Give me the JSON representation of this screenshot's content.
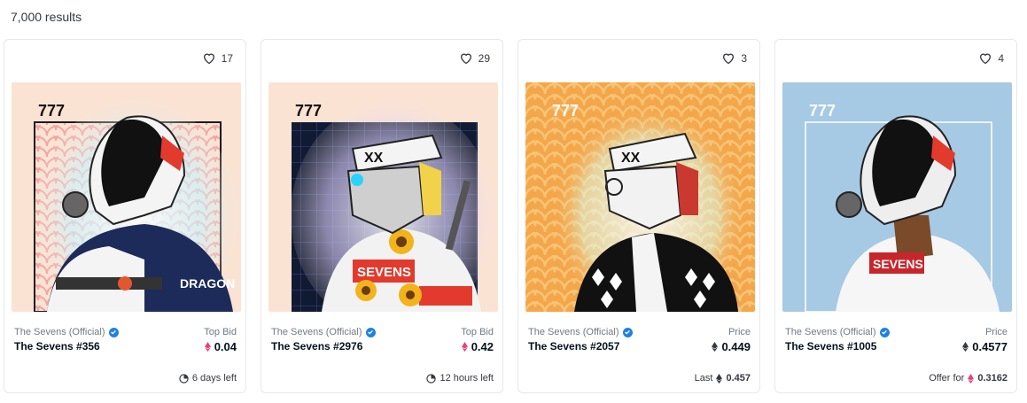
{
  "results_text": "7,000 results",
  "colors": {
    "accent": "#2081e2",
    "eth_pink": "#e0467c",
    "eth_dark": "#353840"
  },
  "cards": [
    {
      "likes": "17",
      "collection": "The Sevens (Official)",
      "name": "The Sevens #356",
      "price_label": "Top Bid",
      "price": "0.04",
      "price_icon": "eth-weth-icon",
      "footer_prefix": "",
      "footer_value": "6 days left",
      "footer_icon": "clock-icon",
      "bg": "#fbe3d3",
      "pattern": "#f3a4a2",
      "frame_num": "777",
      "jacket": "DRAGON"
    },
    {
      "likes": "29",
      "collection": "The Sevens (Official)",
      "name": "The Sevens #2976",
      "price_label": "Top Bid",
      "price": "0.42",
      "price_icon": "eth-weth-icon",
      "footer_prefix": "",
      "footer_value": "12 hours left",
      "footer_icon": "clock-icon",
      "bg": "#fbe3d3",
      "pattern": "#1d2a4a",
      "frame_num": "777",
      "jacket": "SEVENS"
    },
    {
      "likes": "3",
      "collection": "The Sevens (Official)",
      "name": "The Sevens #2057",
      "price_label": "Price",
      "price": "0.449",
      "price_icon": "eth-icon",
      "footer_prefix": "Last",
      "footer_value": "0.457",
      "footer_icon": "eth-icon",
      "bg": "#f4a64a",
      "pattern": "#f7c476",
      "frame_num": "777",
      "jacket": ""
    },
    {
      "likes": "4",
      "collection": "The Sevens (Official)",
      "name": "The Sevens #1005",
      "price_label": "Price",
      "price": "0.4577",
      "price_icon": "eth-icon",
      "footer_prefix": "Offer for",
      "footer_value": "0.3162",
      "footer_icon": "eth-weth-icon",
      "bg": "#a6c9e4",
      "pattern": "#a6c9e4",
      "frame_num": "777",
      "jacket": "SEVENS"
    }
  ]
}
